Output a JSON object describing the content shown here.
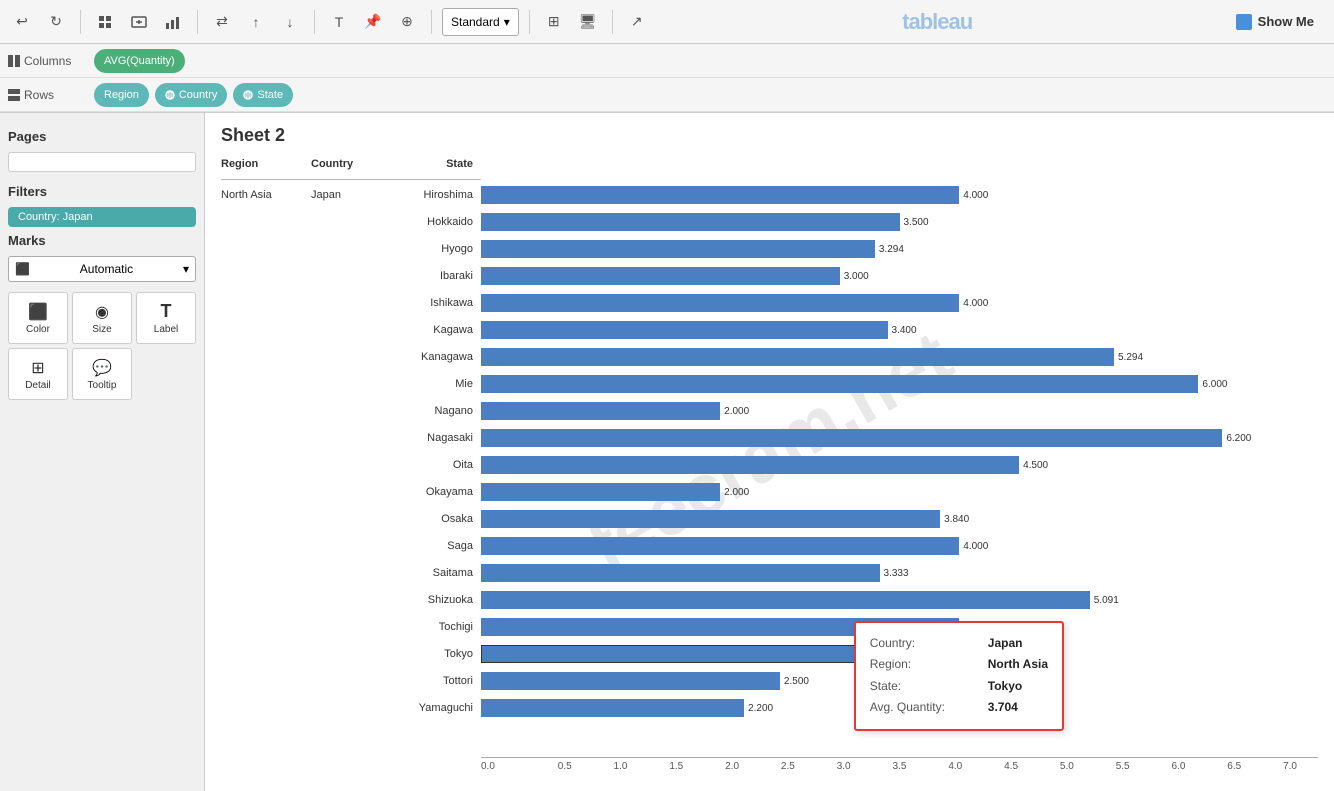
{
  "toolbar": {
    "undo_label": "↩",
    "redo_label": "↻",
    "standard_label": "Standard",
    "show_me_label": "Show Me"
  },
  "shelf": {
    "columns_label": "Columns",
    "rows_label": "Rows",
    "columns_pills": [
      {
        "label": "AVG(Quantity)",
        "type": "green"
      }
    ],
    "rows_pills": [
      {
        "label": "Region",
        "type": "teal"
      },
      {
        "label": "Country",
        "type": "teal"
      },
      {
        "label": "State",
        "type": "teal"
      }
    ]
  },
  "sidebar": {
    "pages_label": "Pages",
    "filters_label": "Filters",
    "filter_value": "Country: Japan",
    "marks_label": "Marks",
    "marks_type": "Automatic",
    "marks_buttons": [
      {
        "label": "Color",
        "icon": "⬛"
      },
      {
        "label": "Size",
        "icon": "◉"
      },
      {
        "label": "Label",
        "icon": "𝐓"
      },
      {
        "label": "Detail",
        "icon": "⊞"
      },
      {
        "label": "Tooltip",
        "icon": "💬"
      }
    ]
  },
  "chart": {
    "sheet_title": "Sheet 2",
    "headers": {
      "region": "Region",
      "country": "Country",
      "state": "State"
    },
    "rows": [
      {
        "region": "North Asia",
        "country": "Japan",
        "state": "Hiroshima",
        "value": 4.0,
        "display": "4.000"
      },
      {
        "region": "",
        "country": "",
        "state": "Hokkaido",
        "value": 3.5,
        "display": "3.500"
      },
      {
        "region": "",
        "country": "",
        "state": "Hyogo",
        "value": 3.294,
        "display": "3.294"
      },
      {
        "region": "",
        "country": "",
        "state": "Ibaraki",
        "value": 3.0,
        "display": "3.000"
      },
      {
        "region": "",
        "country": "",
        "state": "Ishikawa",
        "value": 4.0,
        "display": "4.000"
      },
      {
        "region": "",
        "country": "",
        "state": "Kagawa",
        "value": 3.4,
        "display": "3.400"
      },
      {
        "region": "",
        "country": "",
        "state": "Kanagawa",
        "value": 5.294,
        "display": "5.294"
      },
      {
        "region": "",
        "country": "",
        "state": "Mie",
        "value": 6.0,
        "display": "6.000"
      },
      {
        "region": "",
        "country": "",
        "state": "Nagano",
        "value": 2.0,
        "display": "2.000"
      },
      {
        "region": "",
        "country": "",
        "state": "Nagasaki",
        "value": 6.2,
        "display": "6.200"
      },
      {
        "region": "",
        "country": "",
        "state": "Oita",
        "value": 4.5,
        "display": "4.500"
      },
      {
        "region": "",
        "country": "",
        "state": "Okayama",
        "value": 2.0,
        "display": "2.000"
      },
      {
        "region": "",
        "country": "",
        "state": "Osaka",
        "value": 3.84,
        "display": "3.840"
      },
      {
        "region": "",
        "country": "",
        "state": "Saga",
        "value": 4.0,
        "display": "4.000"
      },
      {
        "region": "",
        "country": "",
        "state": "Saitama",
        "value": 3.333,
        "display": "3.333"
      },
      {
        "region": "",
        "country": "",
        "state": "Shizuoka",
        "value": 5.091,
        "display": "5.091"
      },
      {
        "region": "",
        "country": "",
        "state": "Tochigi",
        "value": 4.0,
        "display": "4.000"
      },
      {
        "region": "",
        "country": "",
        "state": "Tokyo",
        "value": 3.704,
        "display": "3.704",
        "highlighted": true
      },
      {
        "region": "",
        "country": "",
        "state": "Tottori",
        "value": 2.5,
        "display": "2.500"
      },
      {
        "region": "",
        "country": "",
        "state": "Yamaguchi",
        "value": 2.2,
        "display": "2.200"
      }
    ],
    "max_value": 7.0,
    "x_axis_ticks": [
      "0.0",
      "0.5",
      "1.0",
      "1.5",
      "2.0",
      "2.5",
      "3.0",
      "3.5",
      "4.0",
      "4.5",
      "5.0",
      "5.5",
      "6.0",
      "6.5",
      "7.0"
    ],
    "x_axis_max": 7.0
  },
  "tooltip": {
    "country_label": "Country:",
    "country_value": "Japan",
    "region_label": "Region:",
    "region_value": "North Asia",
    "state_label": "State:",
    "state_value": "Tokyo",
    "avg_label": "Avg. Quantity:",
    "avg_value": "3.704"
  }
}
